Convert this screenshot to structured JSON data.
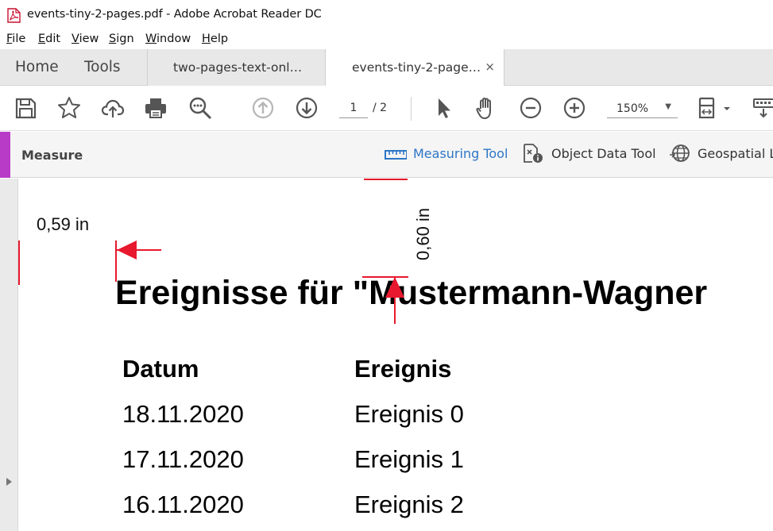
{
  "window": {
    "title": "events-tiny-2-pages.pdf - Adobe Acrobat Reader DC",
    "app_icon": "pdf-file-icon"
  },
  "menu": {
    "items": [
      "File",
      "Edit",
      "View",
      "Sign",
      "Window",
      "Help"
    ]
  },
  "tabs": {
    "home": "Home",
    "tools": "Tools",
    "documents": [
      {
        "label": "two-pages-text-onl…",
        "active": false
      },
      {
        "label": "events-tiny-2-page…",
        "active": true,
        "close": "×"
      }
    ]
  },
  "toolbar": {
    "icons": [
      "save-icon",
      "bookmark-star-icon",
      "upload-cloud-icon",
      "print-icon",
      "find-text-icon",
      "previous-page-icon",
      "next-page-icon",
      "select-pointer-icon",
      "hand-tool-icon",
      "zoom-out-icon",
      "zoom-in-icon",
      "fit-page-icon",
      "keyboard-icon"
    ],
    "current_page": "1",
    "total_pages": "/ 2",
    "zoom": "150%"
  },
  "measure_bar": {
    "title": "Measure",
    "accent_color": "#b73bc6",
    "tools": [
      {
        "label": "Measuring Tool",
        "icon": "ruler-icon",
        "active": true,
        "color": "#2d76c5"
      },
      {
        "label": "Object Data Tool",
        "icon": "object-data-icon",
        "active": false
      },
      {
        "label": "Geospatial Lo",
        "icon": "globe-icon",
        "active": false
      }
    ]
  },
  "document": {
    "heading": "Ereignisse für \"Mustermann-Wagner",
    "table": {
      "headers": [
        "Datum",
        "Ereignis"
      ],
      "rows": [
        [
          "18.11.2020",
          "Ereignis 0"
        ],
        [
          "17.11.2020",
          "Ereignis 1"
        ],
        [
          "16.11.2020",
          "Ereignis 2"
        ]
      ]
    },
    "measurements": {
      "horizontal": "0,59 in",
      "vertical": "0,60 in",
      "markup_color": "#e8182e"
    }
  }
}
